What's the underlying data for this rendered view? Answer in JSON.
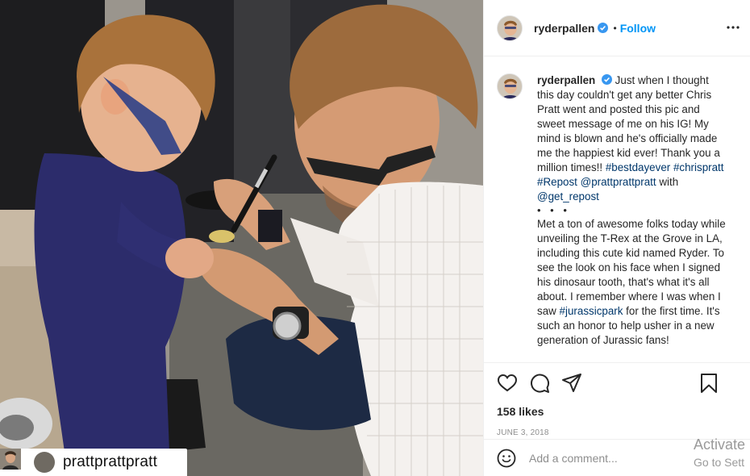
{
  "photo": {
    "repost_username": "prattprattpratt",
    "icons": {
      "repost_user": "user-icon",
      "repost_avatar": "avatar"
    }
  },
  "post": {
    "username": "ryderpallen",
    "follow_label": "Follow",
    "separator": "•",
    "caption": {
      "author": "ryderpallen",
      "text_1": "Just when I thought this day couldn't get any better Chris Pratt went and posted this pic and sweet message of me on his IG! My mind is blown and he's officially made me the happiest kid ever! Thank you a million times!! ",
      "tag_1": "#bestdayever",
      "tag_2": "#chrispratt",
      "tag_3": "#Repost",
      "mention_1": "@prattprattpratt",
      "with_word": "with",
      "mention_2": "@get_repost",
      "dots": "• • •",
      "text_2": "Met a ton of awesome folks today while unveiling the T-Rex at the Grove in LA, including this cute kid named Ryder. To see the look on his face when I signed his dinosaur tooth, that's what it's all about. I remember where I was when I saw ",
      "tag_4": "#jurassicpark",
      "text_3": " for the first time. It's such an honor to help usher in a new generation of Jurassic fans!"
    },
    "likes": "158 likes",
    "date": "JUNE 3, 2018",
    "comment_placeholder": "Add a comment...",
    "icons": {
      "verified": "verified-badge-icon",
      "more": "more-options-icon",
      "like": "heart-icon",
      "comment": "comment-icon",
      "share": "paper-plane-icon",
      "save": "bookmark-icon",
      "emoji": "emoji-icon"
    }
  },
  "watermark": {
    "line1": "Activate",
    "line2": "Go to Sett"
  },
  "colors": {
    "link": "#00376b",
    "follow": "#0095f6",
    "verified": "#3897f0",
    "muted": "#8e8e8e"
  }
}
